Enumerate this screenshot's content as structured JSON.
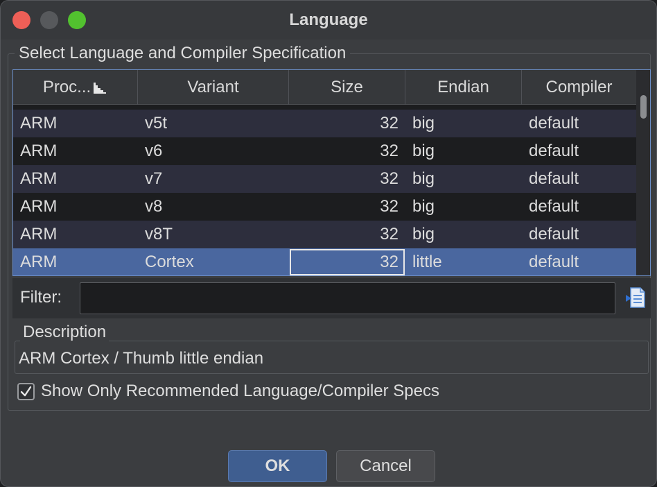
{
  "window": {
    "title": "Language"
  },
  "group": {
    "title": "Select Language and Compiler Specification"
  },
  "table": {
    "columns": [
      "Proc...",
      "Variant",
      "Size",
      "Endian",
      "Compiler"
    ],
    "rows": [
      {
        "processor": "ARM",
        "variant": "v5t",
        "size": "32",
        "endian": "big",
        "compiler": "default"
      },
      {
        "processor": "ARM",
        "variant": "v6",
        "size": "32",
        "endian": "big",
        "compiler": "default"
      },
      {
        "processor": "ARM",
        "variant": "v7",
        "size": "32",
        "endian": "big",
        "compiler": "default"
      },
      {
        "processor": "ARM",
        "variant": "v8",
        "size": "32",
        "endian": "big",
        "compiler": "default"
      },
      {
        "processor": "ARM",
        "variant": "v8T",
        "size": "32",
        "endian": "big",
        "compiler": "default"
      },
      {
        "processor": "ARM",
        "variant": "Cortex",
        "size": "32",
        "endian": "little",
        "compiler": "default"
      }
    ],
    "selected_row": 5
  },
  "filter": {
    "label": "Filter:",
    "value": ""
  },
  "description": {
    "title": "Description",
    "text": "ARM Cortex / Thumb little endian"
  },
  "recommended": {
    "label": "Show Only Recommended Language/Compiler Specs",
    "checked": true
  },
  "buttons": {
    "ok": "OK",
    "cancel": "Cancel"
  },
  "colors": {
    "selection": "#4a679f",
    "ok_button": "#3f5e90",
    "close": "#ee5f57",
    "maximize": "#52c12f"
  }
}
